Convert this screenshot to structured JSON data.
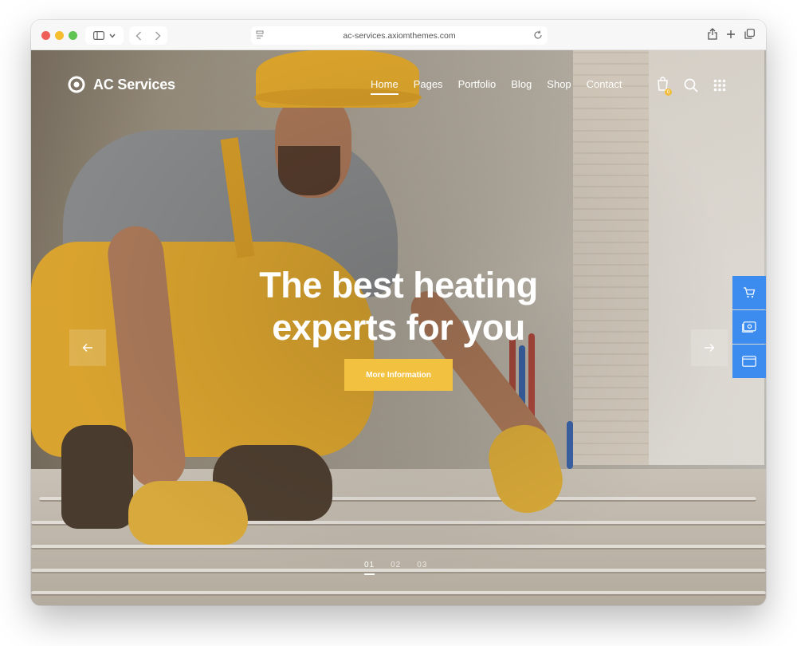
{
  "browser": {
    "url": "ac-services.axiomthemes.com"
  },
  "site": {
    "logo_text": "AC Services",
    "nav": [
      {
        "label": "Home",
        "active": true
      },
      {
        "label": "Pages",
        "active": false
      },
      {
        "label": "Portfolio",
        "active": false
      },
      {
        "label": "Blog",
        "active": false
      },
      {
        "label": "Shop",
        "active": false
      },
      {
        "label": "Contact",
        "active": false
      }
    ],
    "cart_count": "0"
  },
  "hero": {
    "title_line1": "The best heating",
    "title_line2": "experts for you",
    "cta_label": "More Information",
    "slides": [
      "01",
      "02",
      "03"
    ],
    "active_slide": "01"
  },
  "colors": {
    "accent": "#f2c13f",
    "side_widget": "#3c8cf0"
  },
  "icons": {
    "header": [
      "cart-icon",
      "search-icon",
      "grid-menu-icon"
    ],
    "side_widget": [
      "cart-icon",
      "image-settings-icon",
      "window-icon"
    ]
  }
}
